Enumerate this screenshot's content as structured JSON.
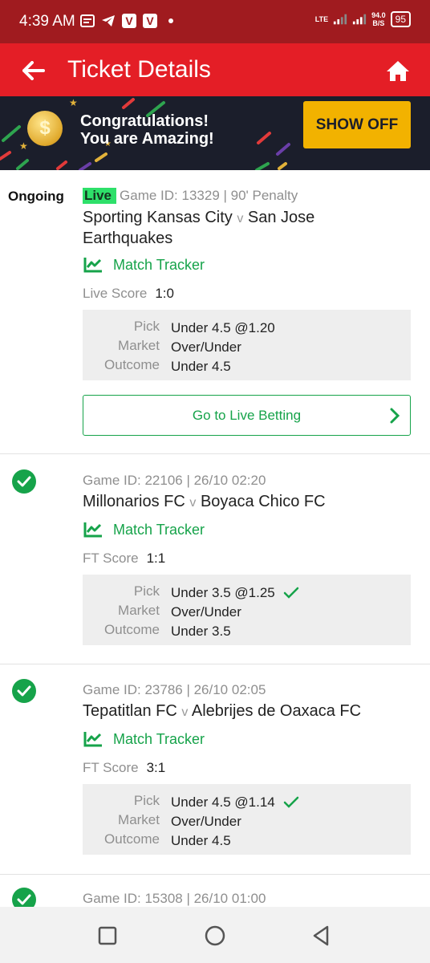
{
  "status_bar": {
    "time": "4:39 AM",
    "network": "LTE",
    "speed_value": "94.0",
    "speed_unit": "B/S",
    "battery": "95",
    "notification_icons": [
      "message-icon",
      "telegram-icon",
      "v-app-icon",
      "v-app-icon"
    ]
  },
  "app_bar": {
    "title": "Ticket Details",
    "back_icon": "arrow-left-icon",
    "home_icon": "home-icon"
  },
  "banner": {
    "line1": "Congratulations!",
    "line2": "You are Amazing!",
    "button_label": "SHOW OFF",
    "button_color": "#f2b200",
    "background": "#1b1e2b"
  },
  "tickets": [
    {
      "status": "Ongoing",
      "live_label": "Live",
      "game_info": "Game ID: 13329 | 90' Penalty",
      "home": "Sporting Kansas City",
      "vs": "v",
      "away": "San Jose Earthquakes",
      "tracker_label": "Match Tracker",
      "score_label": "Live Score",
      "score": "1:0",
      "pick_label": "Pick",
      "pick": "Under 4.5 @1.20",
      "market_label": "Market",
      "market": "Over/Under",
      "outcome_label": "Outcome",
      "outcome": "Under 4.5",
      "cta": "Go to Live Betting"
    },
    {
      "status_icon": "check-circle-icon",
      "game_info": "Game ID: 22106 | 26/10 02:20",
      "home": "Millonarios FC",
      "vs": "v",
      "away": "Boyaca Chico FC",
      "tracker_label": "Match Tracker",
      "score_label": "FT Score",
      "score": "1:1",
      "pick_label": "Pick",
      "pick": "Under 3.5 @1.25",
      "market_label": "Market",
      "market": "Over/Under",
      "outcome_label": "Outcome",
      "outcome": "Under 3.5"
    },
    {
      "status_icon": "check-circle-icon",
      "game_info": "Game ID: 23786 | 26/10 02:05",
      "home": "Tepatitlan FC",
      "vs": "v",
      "away": "Alebrijes de Oaxaca FC",
      "tracker_label": "Match Tracker",
      "score_label": "FT Score",
      "score": "3:1",
      "pick_label": "Pick",
      "pick": "Under 4.5 @1.14",
      "market_label": "Market",
      "market": "Over/Under",
      "outcome_label": "Outcome",
      "outcome": "Under 4.5"
    },
    {
      "status_icon": "check-circle-icon",
      "game_info": "Game ID: 15308 | 26/10 01:00"
    }
  ],
  "colors": {
    "brand_red": "#e41e26",
    "status_red": "#a01b1f",
    "win_green": "#16a34a",
    "live_green": "#2ee06a"
  }
}
